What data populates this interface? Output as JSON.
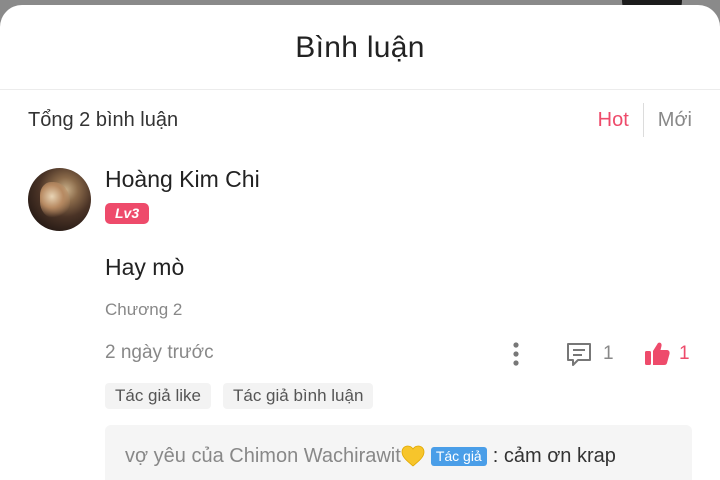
{
  "header": {
    "title": "Bình luận"
  },
  "subbar": {
    "total": "Tổng 2 bình luận",
    "sort_hot": "Hot",
    "sort_new": "Mới"
  },
  "comment": {
    "author": "Hoàng Kim Chi",
    "level": "Lv3",
    "text": "Hay mò",
    "chapter": "Chương 2",
    "time": "2 ngày trước",
    "reply_count": "1",
    "like_count": "1",
    "tags": [
      "Tác giả like",
      "Tác giả bình luận"
    ],
    "reply": {
      "name": "vợ yêu của Chimon Wachirawit",
      "badge": "Tác giả",
      "text": ": cảm ơn krap"
    }
  },
  "colors": {
    "accent": "#ee4b6b",
    "badge_blue": "#4a9ee8"
  },
  "icons": [
    "more-vertical-icon",
    "comment-icon",
    "thumbs-up-icon",
    "yellow-heart-icon"
  ]
}
